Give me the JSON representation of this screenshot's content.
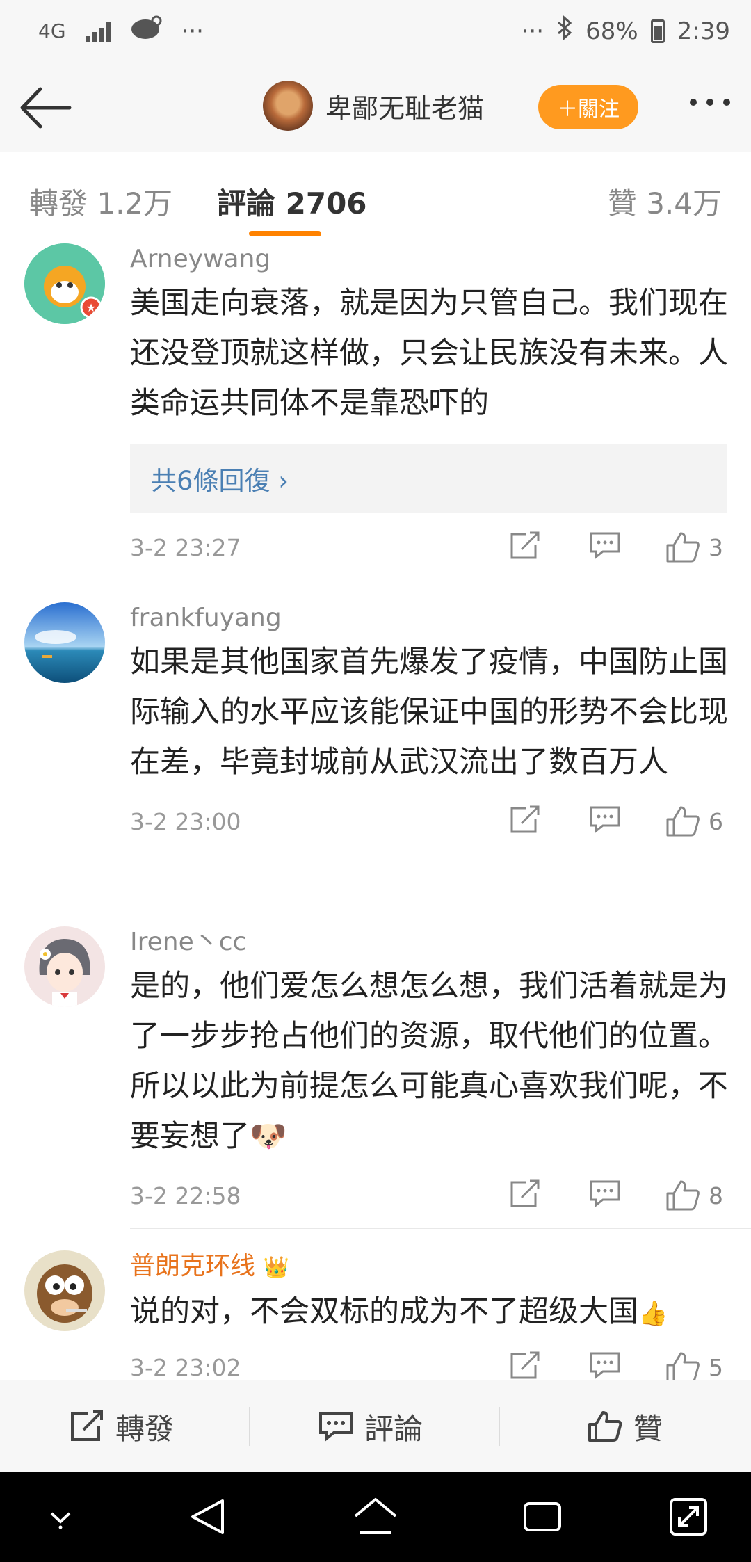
{
  "status": {
    "network": "4G",
    "dots_left": "···",
    "dots_right": "···",
    "battery": "68%",
    "time": "2:39"
  },
  "header": {
    "name": "卑鄙无耻老猫",
    "follow_label": "＋關注"
  },
  "tabs": {
    "repost": "轉發 1.2万",
    "comments": "評論 2706",
    "likes": "贊 3.4万"
  },
  "comments": [
    {
      "user": "Arneywang",
      "text": "美国走向衰落，就是因为只管自己。我们现在还没登顶就这样做，只会让民族没有未来。人类命运共同体不是靠恐吓的",
      "replies": "共6條回復 ›",
      "time": "3-2 23:27",
      "likes": "3"
    },
    {
      "user": "frankfuyang",
      "text": "如果是其他国家首先爆发了疫情，中国防止国际输入的水平应该能保证中国的形势不会比现在差，毕竟封城前从武汉流出了数百万人",
      "time": "3-2 23:00",
      "likes": "6"
    },
    {
      "user": "Irene丶cc",
      "text": "是的，他们爱怎么想怎么想，我们活着就是为了一步步抢占他们的资源，取代他们的位置。所以以此为前提怎么可能真心喜欢我们呢，不要妄想了",
      "emoji": "🐶",
      "time": "3-2 22:58",
      "likes": "8"
    },
    {
      "user": "普朗克环线",
      "badge": "👑",
      "text": "说的对，不会双标的成为不了超级大国",
      "emoji": "👍",
      "time": "3-2 23:02",
      "likes": "5"
    }
  ],
  "bottom_bar": {
    "repost": "轉發",
    "comment": "評論",
    "like": "贊"
  },
  "colors": {
    "accent": "#ff8200",
    "follow": "#ff9a1f",
    "link": "#4a7fb3",
    "vip_name": "#e8731c"
  }
}
